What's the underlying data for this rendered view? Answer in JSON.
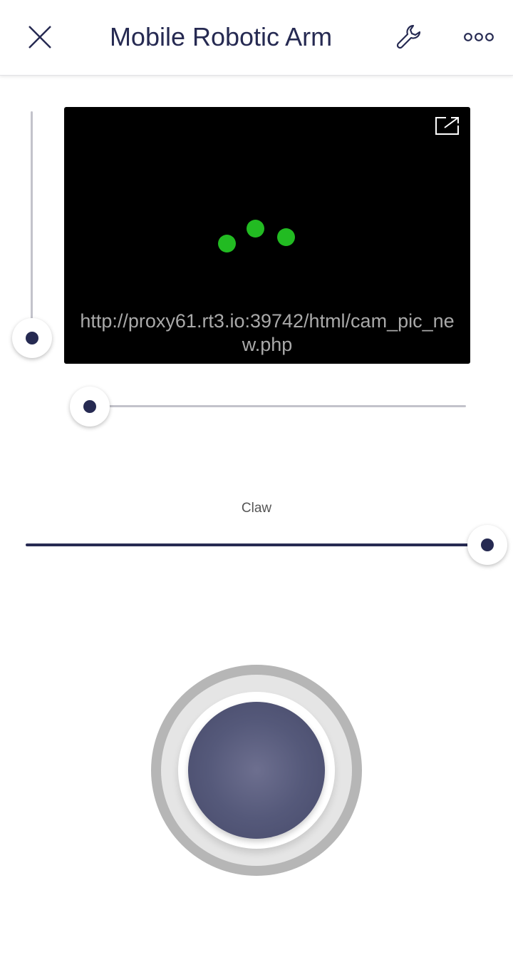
{
  "header": {
    "title": "Mobile Robotic Arm",
    "close_icon": "close-icon",
    "settings_icon": "wrench-icon",
    "more_icon": "more-horizontal-icon"
  },
  "camera": {
    "url": "http://proxy61.rt3.io:39742/html/cam_pic_new.php",
    "expand_icon": "external-link-icon",
    "loading": true
  },
  "vertical_slider": {
    "value": 0.0
  },
  "horizontal_slider": {
    "value": 0.0
  },
  "claw": {
    "label": "Claw",
    "value": 1.0
  },
  "joystick": {
    "x": 0,
    "y": 0
  },
  "colors": {
    "accent": "#262a52",
    "loader": "#22bb22",
    "track": "#c3c3cb",
    "joystick_stick": "#55597a"
  }
}
